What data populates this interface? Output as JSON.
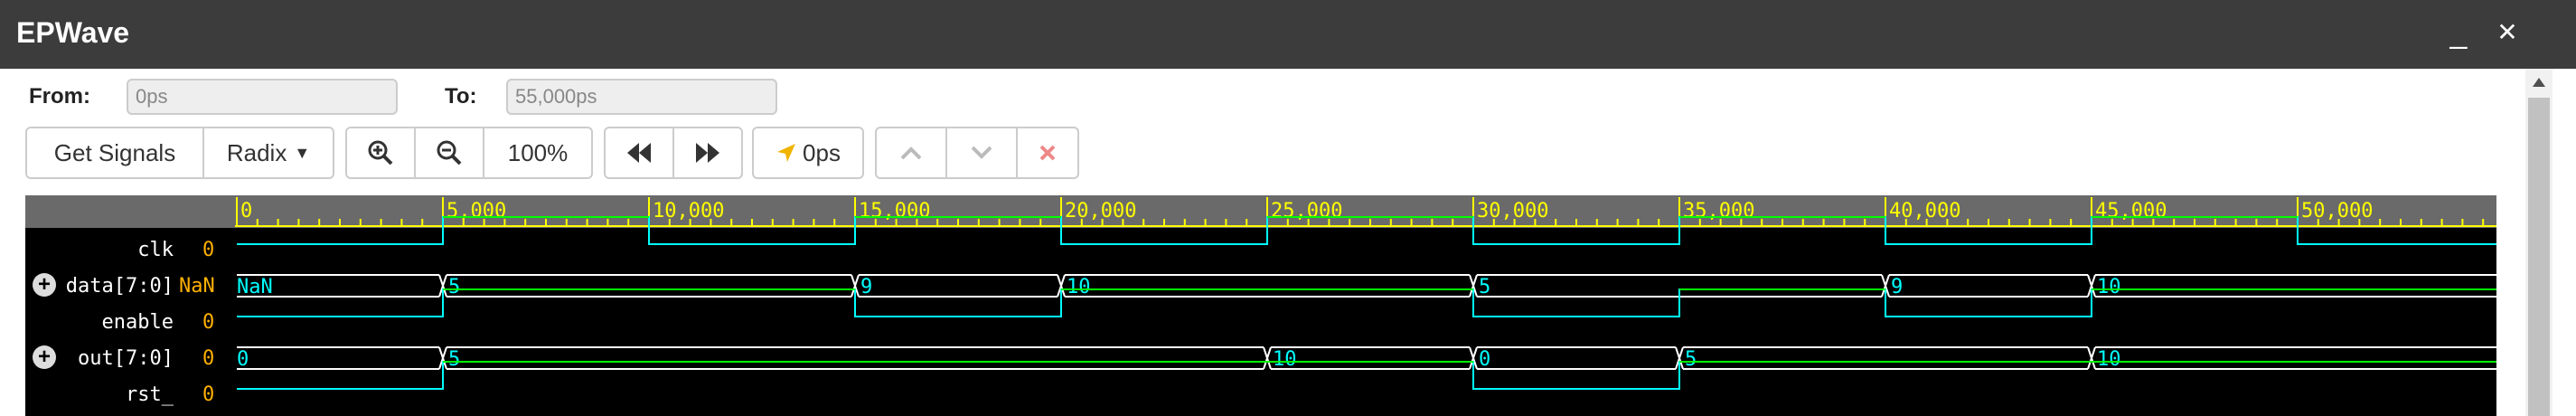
{
  "app": {
    "title": "EPWave"
  },
  "window": {
    "minimize": "_",
    "close": "✕"
  },
  "range": {
    "from_label": "From:",
    "from_value": "0ps",
    "to_label": "To:",
    "to_value": "55,000ps"
  },
  "toolbar": {
    "get_signals": "Get Signals",
    "radix": "Radix",
    "zoom_level": "100%",
    "cursor_time": "0ps"
  },
  "colors": {
    "clk": "#00ffff",
    "high": "#00ff00",
    "bus": "#ffffff",
    "ruler": "#ffff00",
    "value": "#ffb000"
  },
  "ruler": {
    "ticks": [
      "0",
      "5,000",
      "10,000",
      "15,000",
      "20,000",
      "25,000",
      "30,000",
      "35,000",
      "40,000",
      "45,000",
      "50,000"
    ]
  },
  "signals": [
    {
      "name": "clk",
      "value": "0",
      "expandable": false
    },
    {
      "name": "data[7:0]",
      "value": "NaN",
      "expandable": true
    },
    {
      "name": "enable",
      "value": "0",
      "expandable": false
    },
    {
      "name": "out[7:0]",
      "value": "0",
      "expandable": true
    },
    {
      "name": "rst_",
      "value": "0",
      "expandable": false
    }
  ],
  "waves": {
    "clk_edges_ps": [
      0,
      5000,
      10000,
      15000,
      20000,
      25000,
      30000,
      35000,
      40000,
      45000,
      50000,
      55000
    ],
    "clk_levels": [
      0,
      1,
      0,
      1,
      0,
      1,
      0,
      1,
      0,
      1,
      0
    ],
    "data": [
      {
        "start": 0,
        "label": "NaN"
      },
      {
        "start": 5000,
        "label": "5"
      },
      {
        "start": 15000,
        "label": "9"
      },
      {
        "start": 20000,
        "label": "10"
      },
      {
        "start": 30000,
        "label": "5"
      },
      {
        "start": 40000,
        "label": "9"
      },
      {
        "start": 45000,
        "label": "10"
      }
    ],
    "enable_edges_ps": [
      0,
      5000,
      15000,
      20000,
      30000,
      35000,
      40000,
      45000,
      55000
    ],
    "enable_levels": [
      0,
      1,
      0,
      1,
      0,
      1,
      0,
      1
    ],
    "out": [
      {
        "start": 0,
        "label": "0"
      },
      {
        "start": 5000,
        "label": "5"
      },
      {
        "start": 25000,
        "label": "10"
      },
      {
        "start": 30000,
        "label": "0"
      },
      {
        "start": 35000,
        "label": "5"
      },
      {
        "start": 45000,
        "label": "10"
      }
    ],
    "rst_edges_ps": [
      0,
      5000,
      30000,
      35000,
      55000
    ],
    "rst_levels": [
      0,
      1,
      0,
      1
    ]
  }
}
